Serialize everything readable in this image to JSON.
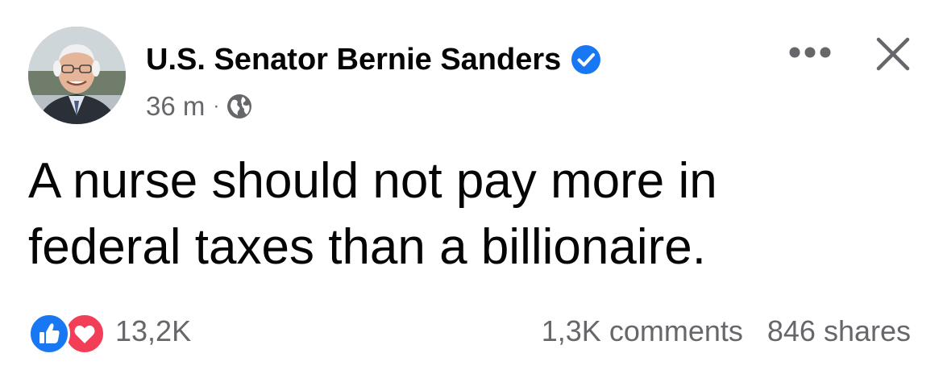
{
  "post": {
    "author": {
      "name": "U.S. Senator Bernie Sanders",
      "verified": true,
      "avatar": "profile-photo"
    },
    "meta": {
      "timestamp": "36 m",
      "separator": "·",
      "audience_icon": "globe-icon"
    },
    "text_line_1": "A nurse should not pay more in",
    "text_line_2": "federal taxes than a billionaire.",
    "reactions": {
      "icons": [
        "like-icon",
        "love-icon"
      ],
      "count": "13,2K"
    },
    "comments": "1,3K comments",
    "shares": "846 shares"
  },
  "colors": {
    "text_primary": "#050505",
    "text_secondary": "#65676b",
    "verified_blue": "#1877f2",
    "like_blue": "#1877f2",
    "love_red": "#f33e58"
  }
}
